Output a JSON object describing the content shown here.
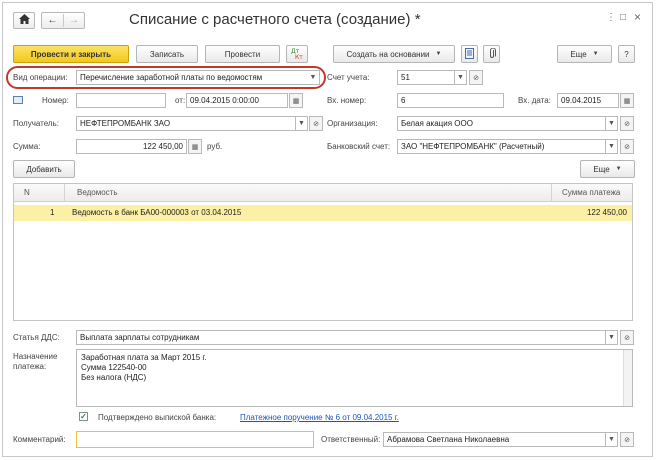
{
  "window": {
    "title": "Списание с расчетного счета (создание) *",
    "home_icon": "home-icon",
    "back_icon": "arrow-left-icon",
    "forward_icon": "arrow-right-icon",
    "menu_glyph": "⋮",
    "maximize_glyph": "□",
    "close_glyph": "×"
  },
  "toolbar": {
    "post_and_close": "Провести и закрыть",
    "save": "Записать",
    "post": "Провести",
    "create_based_on": "Создать на основании",
    "more": "Еще",
    "help": "?"
  },
  "form": {
    "operation_type_label": "Вид операции:",
    "operation_type_value": "Перечисление заработной платы по ведомостям",
    "account_label": "Счет учета:",
    "account_value": "51",
    "number_label": "Номер:",
    "number_value": "",
    "from_label": "от:",
    "from_value": "09.04.2015  0:00:00",
    "in_number_label": "Вх. номер:",
    "in_number_value": "6",
    "in_date_label": "Вх. дата:",
    "in_date_value": "09.04.2015",
    "recipient_label": "Получатель:",
    "recipient_value": "НЕФТЕПРОМБАНК ЗАО",
    "organization_label": "Организация:",
    "organization_value": "Белая акация ООО",
    "amount_label": "Сумма:",
    "amount_value": "122 450,00",
    "currency": "руб.",
    "bank_account_label": "Банковский счет:",
    "bank_account_value": "ЗАО \"НЕФТЕПРОМБАНК\" (Расчетный)"
  },
  "table": {
    "add_button": "Добавить",
    "more_button": "Еще",
    "columns": [
      "N",
      "Ведомость",
      "Сумма платежа"
    ],
    "rows": [
      {
        "n": "1",
        "statement": "Ведомость в банк БА00-000003 от 03.04.2015",
        "amount": "122 450,00"
      }
    ]
  },
  "bottom": {
    "dds_label": "Статья ДДС:",
    "dds_value": "Выплата зарплаты сотрудникам",
    "purpose_label_1": "Назначение",
    "purpose_label_2": "платежа:",
    "purpose_lines": [
      "Заработная плата за Март 2015 г.",
      "Сумма 122540-00",
      "Без налога (НДС)"
    ],
    "confirmed_label": "Подтверждено выпиской банка:",
    "confirmed_link": "Платежное поручение № 6 от 09.04.2015 г.",
    "comment_label": "Комментарий:",
    "comment_value": "",
    "responsible_label": "Ответственный:",
    "responsible_value": "Абрамова Светлана Николаевна"
  },
  "colors": {
    "primary_button": "#f2c81a",
    "highlight_oval": "#c0392b",
    "selected_row": "#fbf0a6",
    "link": "#1a55c0"
  }
}
